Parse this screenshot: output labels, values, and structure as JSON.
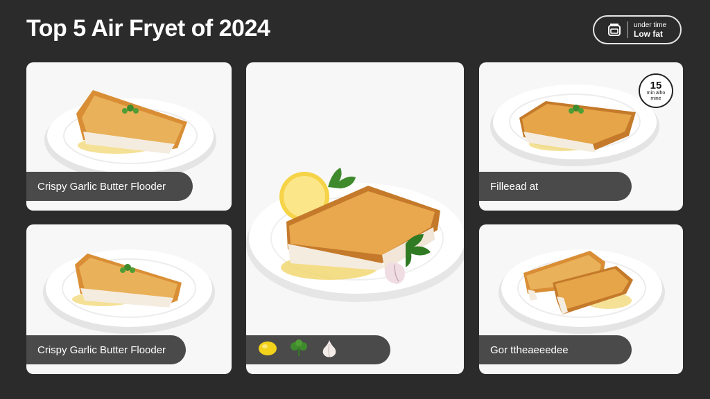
{
  "header": {
    "title": "Top 5 Air Fryet of 2024",
    "badge": {
      "icon": "air-fryer-icon",
      "line1": "under time",
      "line2": "Low fat"
    }
  },
  "cards": [
    {
      "label": "Crispy Garlic Butter Flooder"
    },
    {
      "label": "Crispy Garlic Butter Flooder"
    },
    {
      "ingredients": [
        "lemon-icon",
        "parsley-icon",
        "garlic-icon"
      ]
    },
    {
      "label": "Filleead at",
      "timer": {
        "value": "15",
        "line1": "min alho",
        "line2": "mine"
      }
    },
    {
      "label": "Gor ttheaeeedee"
    }
  ],
  "colors": {
    "background": "#2b2b2b",
    "card": "#f7f7f7",
    "pill": "#4a4a4a",
    "fish": "#e8a94a"
  }
}
